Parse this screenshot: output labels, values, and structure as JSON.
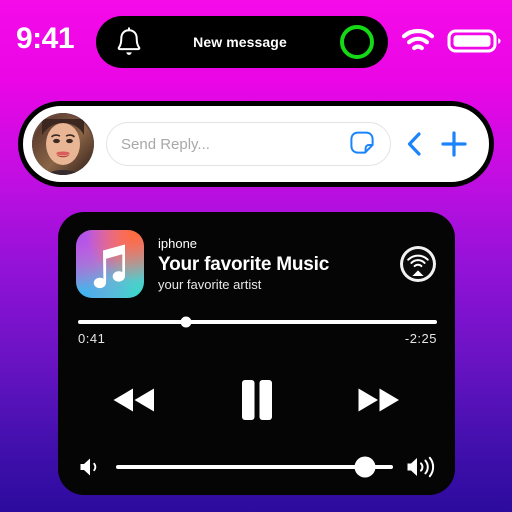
{
  "theme": {
    "background_top": "#f50ae8",
    "background_mid": "#9412d8",
    "background_bottom": "#2c0b9e",
    "accent_blue": "#1b84fb",
    "island_ring_green": "#15d915",
    "card_black": "#050505"
  },
  "status_bar": {
    "time": "9:41",
    "bell_icon": "bell-icon",
    "wifi_icon": "wifi-icon",
    "battery_icon": "battery-icon",
    "battery_level_percent": 100,
    "dynamic_island": {
      "title": "New message",
      "ring_icon": "recording-ring-icon"
    }
  },
  "reply_bar": {
    "avatar_icon": "avatar",
    "input": {
      "placeholder": "Send Reply...",
      "value": ""
    },
    "sticker_icon": "sticker-icon",
    "back_icon": "chevron-left-icon",
    "add_icon": "plus-icon"
  },
  "player": {
    "album_art_icon": "music-note-icon",
    "device": "iphone",
    "title": "Your favorite Music",
    "artist": "your favorite artist",
    "airplay_icon": "airplay-icon",
    "progress": {
      "elapsed": "0:41",
      "remaining": "-2:25",
      "percent": 30
    },
    "controls": {
      "rewind_icon": "rewind-icon",
      "pause_icon": "pause-icon",
      "forward_icon": "fast-forward-icon"
    },
    "volume": {
      "min_icon": "volume-low-icon",
      "max_icon": "volume-high-icon",
      "percent": 90
    }
  }
}
